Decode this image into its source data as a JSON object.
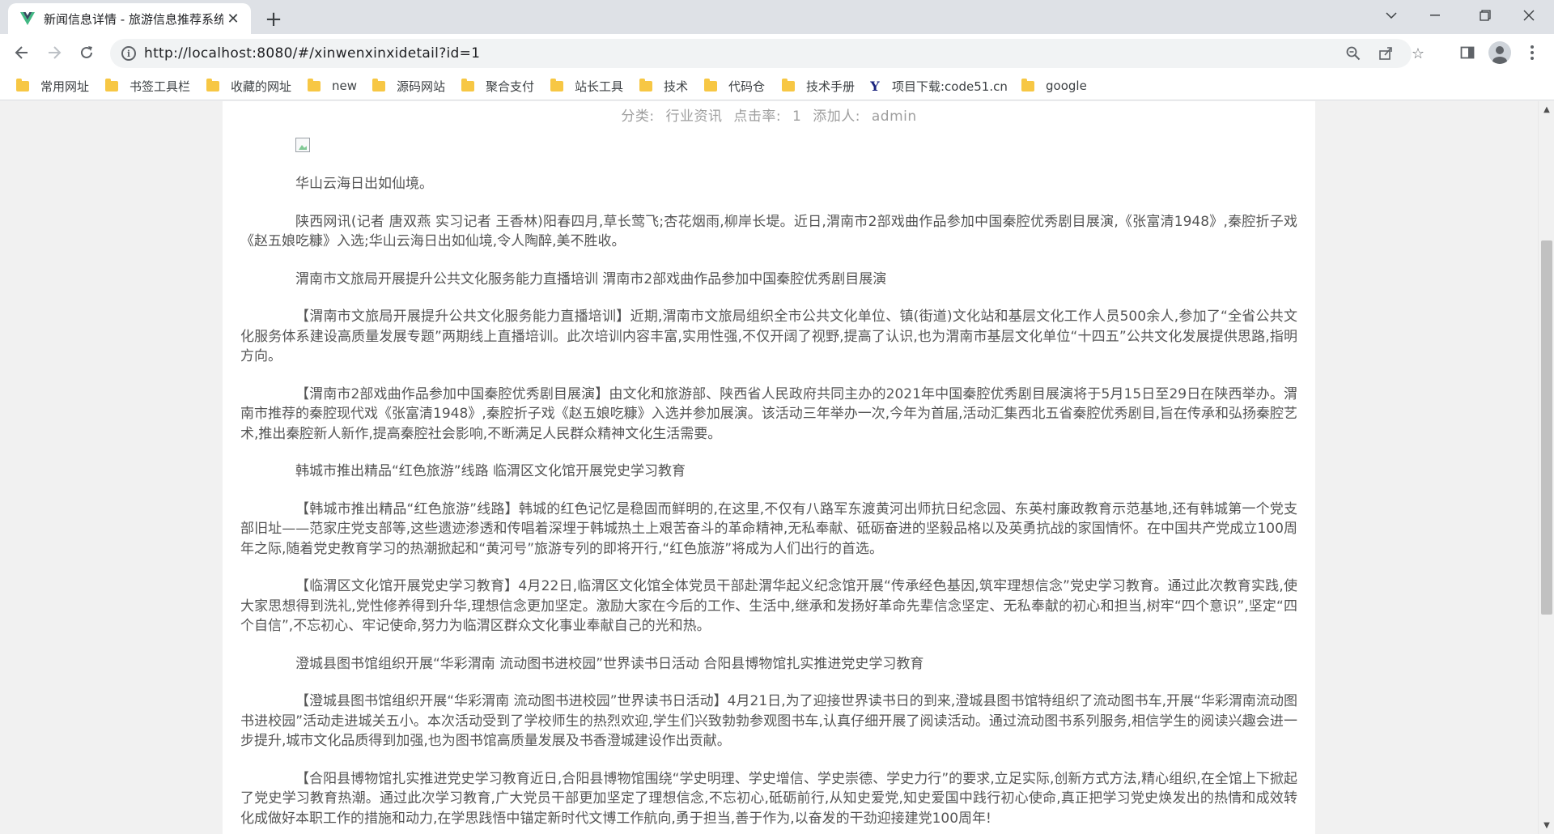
{
  "browser": {
    "tab": {
      "title": "新闻信息详情 - 旅游信息推荐系统",
      "favicon": "vue-logo-icon"
    },
    "url": "http://localhost:8080/#/xinwenxinxidetail?id=1",
    "bookmarks": [
      {
        "label": "常用网址",
        "icon": "folder-icon"
      },
      {
        "label": "书签工具栏",
        "icon": "folder-icon"
      },
      {
        "label": "收藏的网址",
        "icon": "folder-icon"
      },
      {
        "label": "new",
        "icon": "folder-icon"
      },
      {
        "label": "源码网站",
        "icon": "folder-icon"
      },
      {
        "label": "聚合支付",
        "icon": "folder-icon"
      },
      {
        "label": "站长工具",
        "icon": "folder-icon"
      },
      {
        "label": "技术",
        "icon": "folder-icon"
      },
      {
        "label": "代码仓",
        "icon": "folder-icon"
      },
      {
        "label": "技术手册",
        "icon": "folder-icon"
      },
      {
        "label": "项目下载:code51.cn",
        "icon": "site-logo-icon"
      },
      {
        "label": "google",
        "icon": "folder-icon"
      }
    ]
  },
  "article": {
    "meta": {
      "category_label": "分类:",
      "category_value": "行业资讯",
      "clicks_label": "点击率:",
      "clicks_value": "1",
      "author_label": "添加人:",
      "author_value": "admin"
    },
    "paragraphs": [
      "华山云海日出如仙境。",
      "陕西网讯(记者 唐双燕 实习记者 王香林)阳春四月,草长莺飞;杏花烟雨,柳岸长堤。近日,渭南市2部戏曲作品参加中国秦腔优秀剧目展演,《张富清1948》,秦腔折子戏《赵五娘吃糠》入选;华山云海日出如仙境,令人陶醉,美不胜收。",
      "渭南市文旅局开展提升公共文化服务能力直播培训 渭南市2部戏曲作品参加中国秦腔优秀剧目展演",
      "【渭南市文旅局开展提升公共文化服务能力直播培训】近期,渭南市文旅局组织全市公共文化单位、镇(街道)文化站和基层文化工作人员500余人,参加了“全省公共文化服务体系建设高质量发展专题”两期线上直播培训。此次培训内容丰富,实用性强,不仅开阔了视野,提高了认识,也为渭南市基层文化单位“十四五”公共文化发展提供思路,指明方向。",
      "【渭南市2部戏曲作品参加中国秦腔优秀剧目展演】由文化和旅游部、陕西省人民政府共同主办的2021年中国秦腔优秀剧目展演将于5月15日至29日在陕西举办。渭南市推荐的秦腔现代戏《张富清1948》,秦腔折子戏《赵五娘吃糠》入选并参加展演。该活动三年举办一次,今年为首届,活动汇集西北五省秦腔优秀剧目,旨在传承和弘扬秦腔艺术,推出秦腔新人新作,提高秦腔社会影响,不断满足人民群众精神文化生活需要。",
      "韩城市推出精品“红色旅游”线路 临渭区文化馆开展党史学习教育",
      "【韩城市推出精品“红色旅游”线路】韩城的红色记忆是稳固而鲜明的,在这里,不仅有八路军东渡黄河出师抗日纪念园、东英村廉政教育示范基地,还有韩城第一个党支部旧址——范家庄党支部等,这些遗迹渗透和传唱着深埋于韩城热土上艰苦奋斗的革命精神,无私奉献、砥砺奋进的坚毅品格以及英勇抗战的家国情怀。在中国共产党成立100周年之际,随着党史教育学习的热潮掀起和“黄河号”旅游专列的即将开行,“红色旅游”将成为人们出行的首选。",
      "【临渭区文化馆开展党史学习教育】4月22日,临渭区文化馆全体党员干部赴渭华起义纪念馆开展“传承经色基因,筑牢理想信念”党史学习教育。通过此次教育实践,使大家思想得到洗礼,党性修养得到升华,理想信念更加坚定。激励大家在今后的工作、生活中,继承和发扬好革命先辈信念坚定、无私奉献的初心和担当,树牢“四个意识”,坚定“四个自信”,不忘初心、牢记使命,努力为临渭区群众文化事业奉献自己的光和热。",
      "澄城县图书馆组织开展“华彩渭南 流动图书进校园”世界读书日活动 合阳县博物馆扎实推进党史学习教育",
      "【澄城县图书馆组织开展“华彩渭南 流动图书进校园”世界读书日活动】4月21日,为了迎接世界读书日的到来,澄城县图书馆特组织了流动图书车,开展“华彩渭南流动图书进校园”活动走进城关五小。本次活动受到了学校师生的热烈欢迎,学生们兴致勃勃参观图书车,认真仔细开展了阅读活动。通过流动图书系列服务,相信学生的阅读兴趣会进一步提升,城市文化品质得到加强,也为图书馆高质量发展及书香澄城建设作出贡献。",
      "【合阳县博物馆扎实推进党史学习教育近日,合阳县博物馆围绕“学史明理、学史增信、学史崇德、学史力行”的要求,立足实际,创新方式方法,精心组织,在全馆上下掀起了党史学习教育热潮。通过此次学习教育,广大党员干部更加坚定了理想信念,不忘初心,砥砺前行,从知史爱党,知史爱国中践行初心使命,真正把学习党史焕发出的热情和成效转化成做好本职工作的措施和动力,在学思践悟中锚定新时代文博工作航向,勇于担当,善于作为,以奋发的干劲迎接建党100周年!"
    ]
  }
}
